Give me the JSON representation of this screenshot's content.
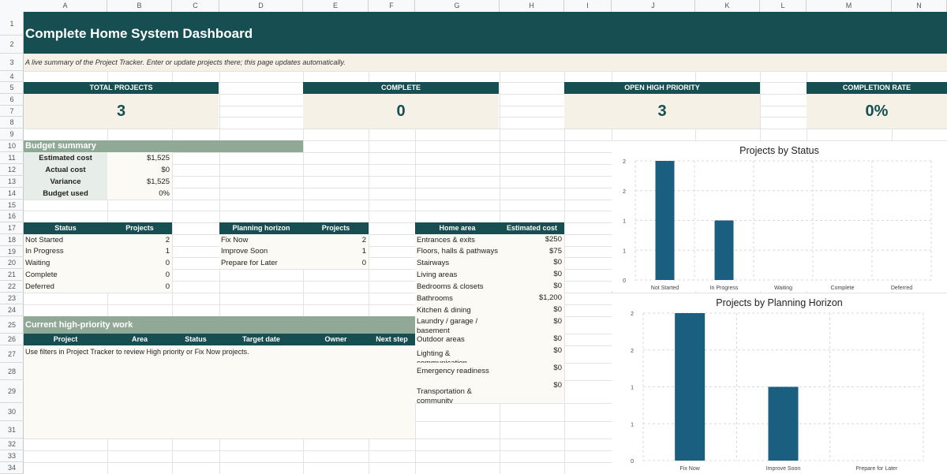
{
  "columns": [
    "A",
    "B",
    "C",
    "D",
    "E",
    "F",
    "G",
    "H",
    "I",
    "J",
    "K",
    "L",
    "M",
    "N"
  ],
  "rows": [
    "1",
    "2",
    "3",
    "4",
    "5",
    "6",
    "7",
    "8",
    "9",
    "10",
    "11",
    "12",
    "13",
    "14",
    "15",
    "16",
    "17",
    "18",
    "19",
    "20",
    "21",
    "22",
    "23",
    "24",
    "25",
    "26",
    "27",
    "28",
    "29",
    "30",
    "31",
    "32",
    "33",
    "34"
  ],
  "title": "Complete Home System Dashboard",
  "subtitle": "A live summary of the Project Tracker. Enter or update projects there; this page updates automatically.",
  "kpis": [
    {
      "label": "TOTAL PROJECTS",
      "value": "3"
    },
    {
      "label": "COMPLETE",
      "value": "0"
    },
    {
      "label": "OPEN HIGH PRIORITY",
      "value": "3"
    },
    {
      "label": "COMPLETION RATE",
      "value": "0%"
    }
  ],
  "budget": {
    "heading": "Budget summary",
    "items": [
      {
        "label": "Estimated cost",
        "value": "$1,525"
      },
      {
        "label": "Actual cost",
        "value": "$0"
      },
      {
        "label": "Variance",
        "value": "$1,525"
      },
      {
        "label": "Budget used",
        "value": "0%"
      }
    ]
  },
  "status_table": {
    "headers": [
      "Status",
      "Projects"
    ],
    "rows": [
      [
        "Not Started",
        "2"
      ],
      [
        "In Progress",
        "1"
      ],
      [
        "Waiting",
        "0"
      ],
      [
        "Complete",
        "0"
      ],
      [
        "Deferred",
        "0"
      ]
    ]
  },
  "horizon_table": {
    "headers": [
      "Planning horizon",
      "Projects"
    ],
    "rows": [
      [
        "Fix Now",
        "2"
      ],
      [
        "Improve Soon",
        "1"
      ],
      [
        "Prepare for Later",
        "0"
      ]
    ]
  },
  "area_table": {
    "headers": [
      "Home area",
      "Estimated cost"
    ],
    "rows": [
      [
        "Entrances & exits",
        "$250"
      ],
      [
        "Floors, halls & pathways",
        "$75"
      ],
      [
        "Stairways",
        "$0"
      ],
      [
        "Living areas",
        "$0"
      ],
      [
        "Bedrooms & closets",
        "$0"
      ],
      [
        "Bathrooms",
        "$1,200"
      ],
      [
        "Kitchen & dining",
        "$0"
      ],
      [
        "Laundry / garage / basement",
        "$0"
      ],
      [
        "Outdoor areas",
        "$0"
      ],
      [
        "Lighting & communication",
        "$0"
      ],
      [
        "Emergency readiness",
        "$0"
      ],
      [
        "Transportation & community",
        "$0"
      ]
    ]
  },
  "priority": {
    "heading": "Current high-priority work",
    "headers": [
      "Project",
      "Area",
      "Status",
      "Target date",
      "Owner",
      "Next step"
    ],
    "note": "Use filters in Project Tracker to review High priority or Fix Now projects."
  },
  "chart_data": [
    {
      "type": "bar",
      "title": "Projects by Status",
      "categories": [
        "Not Started",
        "In Progress",
        "Waiting",
        "Complete",
        "Deferred"
      ],
      "values": [
        2,
        1,
        0,
        0,
        0
      ],
      "yticks": [
        "0",
        "1",
        "1",
        "2",
        "2"
      ],
      "ylim": [
        0,
        2
      ],
      "grid": true,
      "color": "#1a5f80"
    },
    {
      "type": "bar",
      "title": "Projects by Planning Horizon",
      "categories": [
        "Fix Now",
        "Improve Soon",
        "Prepare for Later"
      ],
      "values": [
        2,
        1,
        0
      ],
      "yticks": [
        "0",
        "1",
        "1",
        "2",
        "2"
      ],
      "ylim": [
        0,
        2
      ],
      "grid": true,
      "color": "#1a5f80"
    }
  ]
}
